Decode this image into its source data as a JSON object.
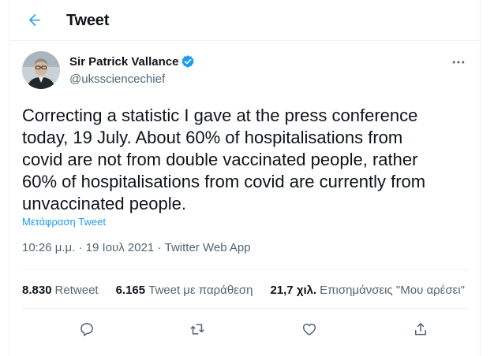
{
  "header": {
    "title": "Tweet",
    "back_icon": "arrow-left-icon"
  },
  "author": {
    "display_name": "Sir Patrick Vallance",
    "handle": "@ukssciencechief",
    "verified": true
  },
  "tweet": {
    "text": "Correcting a statistic I gave at the press conference\ntoday, 19 July. About 60% of hospitalisations from\ncovid are not from double vaccinated people, rather\n60% of hospitalisations from covid are currently from\nunvaccinated people.",
    "translate_label": "Μετάφραση Tweet",
    "time": "10:26 μ.μ.",
    "date": "19 Ιουλ 2021",
    "source": "Twitter Web App",
    "separator": "·"
  },
  "stats": [
    {
      "value": "8.830",
      "label": "Retweet"
    },
    {
      "value": "6.165",
      "label": "Tweet με παράθεση"
    },
    {
      "value": "21,7 χιλ.",
      "label": "Επισημάνσεις \"Μου αρέσει\""
    }
  ],
  "actions": [
    "reply-icon",
    "retweet-icon",
    "like-icon",
    "share-icon"
  ],
  "colors": {
    "accent": "#1d9bf0",
    "text": "#0f1419",
    "secondary": "#536471",
    "border": "#eff3f4"
  }
}
